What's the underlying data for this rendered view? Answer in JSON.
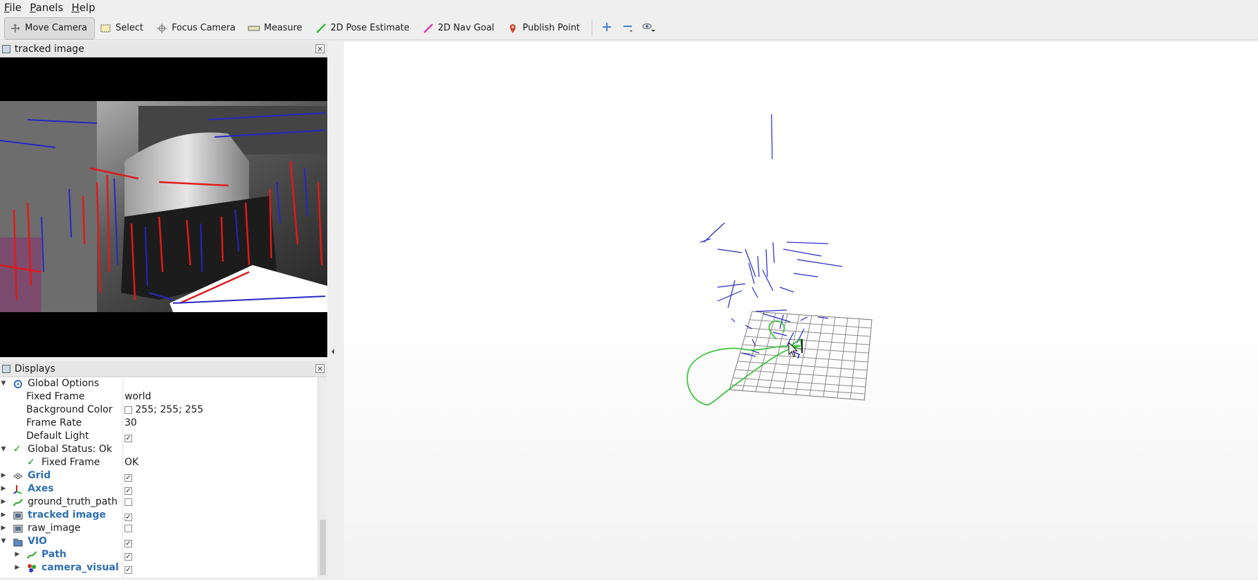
{
  "menu": [
    "File",
    "Panels",
    "Help"
  ],
  "toolbar": {
    "tools": [
      {
        "label": "Move Camera",
        "icon": "move-camera-icon",
        "active": true
      },
      {
        "label": "Select",
        "icon": "select-icon"
      },
      {
        "label": "Focus Camera",
        "icon": "focus-camera-icon"
      },
      {
        "label": "Measure",
        "icon": "measure-icon"
      },
      {
        "label": "2D Pose Estimate",
        "icon": "pose-estimate-icon"
      },
      {
        "label": "2D Nav Goal",
        "icon": "nav-goal-icon"
      },
      {
        "label": "Publish Point",
        "icon": "publish-point-icon"
      }
    ],
    "extra_icons": [
      "plus-icon",
      "minus-icon",
      "eye-icon"
    ]
  },
  "image_panel": {
    "title": "tracked image"
  },
  "displays_panel": {
    "title": "Displays",
    "rows": {
      "global_options": {
        "label": "Global Options"
      },
      "fixed_frame": {
        "label": "Fixed Frame",
        "value": "world"
      },
      "background_color": {
        "label": "Background Color",
        "value": "255; 255; 255"
      },
      "frame_rate": {
        "label": "Frame Rate",
        "value": "30"
      },
      "default_light": {
        "label": "Default Light",
        "checked": true
      },
      "global_status": {
        "label": "Global Status: Ok"
      },
      "status_fixed_frame": {
        "label": "Fixed Frame",
        "value": "OK"
      },
      "grid": {
        "label": "Grid",
        "checked": true
      },
      "axes": {
        "label": "Axes",
        "checked": true
      },
      "ground_truth_path": {
        "label": "ground_truth_path",
        "checked": false
      },
      "tracked_image": {
        "label": "tracked image",
        "checked": true
      },
      "raw_image": {
        "label": "raw_image",
        "checked": false
      },
      "vio": {
        "label": "VIO",
        "checked": true
      },
      "path": {
        "label": "Path",
        "checked": true
      },
      "camera_visual": {
        "label": "camera_visual",
        "checked": true
      }
    }
  },
  "colors": {
    "accent_blue": "#2d6fb3",
    "path_green": "#3cc43c",
    "feature_blue": "#2626c8",
    "edge_red": "#e01a1a"
  }
}
